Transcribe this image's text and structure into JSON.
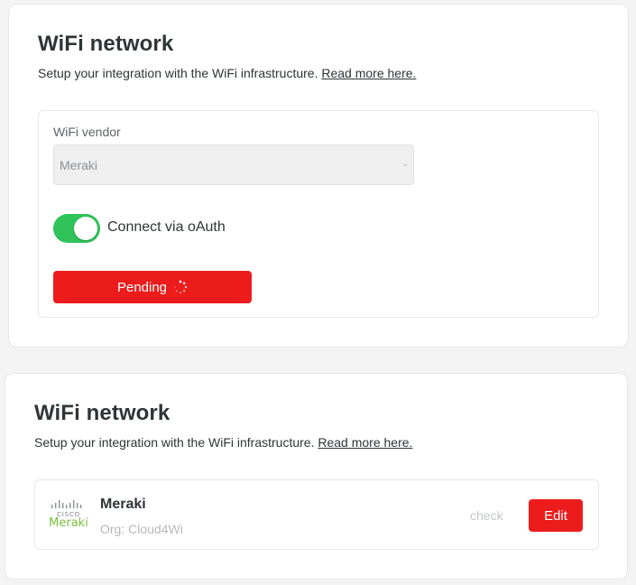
{
  "top_card": {
    "title": "WiFi network",
    "subtitle": "Setup your integration with the WiFi infrastructure.",
    "read_more_link": "Read more here.",
    "vendor_label": "WiFi vendor",
    "vendor_value": "Meraki",
    "oauth_toggle_on": true,
    "oauth_label": "Connect via oAuth",
    "pending_button": "Pending"
  },
  "bottom_card": {
    "title": "WiFi network",
    "subtitle": "Setup your integration with the WiFi infrastructure.",
    "read_more_link": "Read more here.",
    "integration": {
      "logo_top": "CISCO",
      "logo_brand": "Meraki",
      "name": "Meraki",
      "org": "Org: Cloud4Wi",
      "check_link": "check",
      "edit_button": "Edit"
    }
  },
  "colors": {
    "accent_red": "#ec1c1c",
    "toggle_green": "#2fc35a",
    "meraki_green": "#7bbf3c"
  }
}
